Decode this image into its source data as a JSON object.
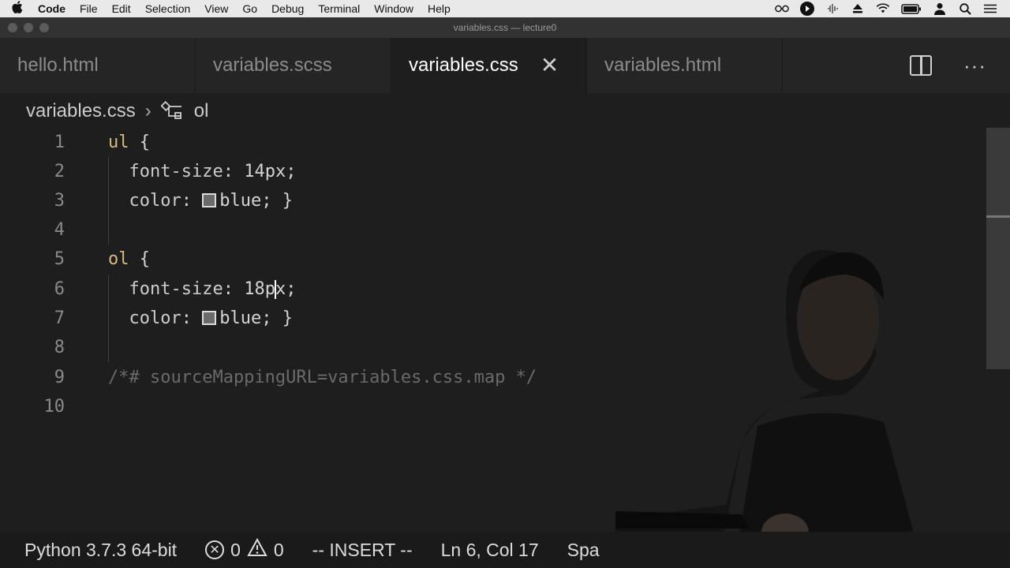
{
  "menubar": {
    "apple_icon": "apple-logo-icon",
    "app_name": "Code",
    "items": [
      "File",
      "Edit",
      "Selection",
      "View",
      "Go",
      "Debug",
      "Terminal",
      "Window",
      "Help"
    ],
    "status_icons": [
      "glasses-icon",
      "play-circle-icon",
      "audio-icon",
      "eject-icon",
      "wifi-icon",
      "battery-icon",
      "user-icon",
      "search-icon",
      "list-icon"
    ]
  },
  "window": {
    "title": "variables.css — lecture0"
  },
  "tabs": [
    {
      "label": "hello.html",
      "active": false
    },
    {
      "label": "variables.scss",
      "active": false
    },
    {
      "label": "variables.css",
      "active": true,
      "close": "✕"
    },
    {
      "label": "variables.html",
      "active": false
    }
  ],
  "tab_actions": {
    "split_icon": "split-editor-icon",
    "more": "···"
  },
  "breadcrumb": {
    "file": "variables.css",
    "separator": "›",
    "symbol_icon": "symbol-structure-icon",
    "symbol": "ol"
  },
  "editor": {
    "lines": [
      {
        "n": "1",
        "selector": "ul",
        "rest": " {"
      },
      {
        "n": "2",
        "prop": "font-size",
        "value": " 14px;"
      },
      {
        "n": "3",
        "prop": "color",
        "value": "blue; }"
      },
      {
        "n": "4"
      },
      {
        "n": "5",
        "selector": "ol",
        "rest": " {"
      },
      {
        "n": "6",
        "prop": "font-size",
        "value_before_cursor": " 18p",
        "value_after_cursor": "x;"
      },
      {
        "n": "7",
        "prop": "color",
        "value": "blue; }"
      },
      {
        "n": "8"
      },
      {
        "n": "9",
        "comment": "/*# sourceMappingURL=variables.css.map */"
      },
      {
        "n": "10"
      }
    ],
    "swatch_color": "#0000ff"
  },
  "statusbar": {
    "python": "Python 3.7.3 64-bit",
    "errors": "0",
    "warnings": "0",
    "mode": "-- INSERT --",
    "position": "Ln 6, Col 17",
    "indent": "Spa"
  }
}
